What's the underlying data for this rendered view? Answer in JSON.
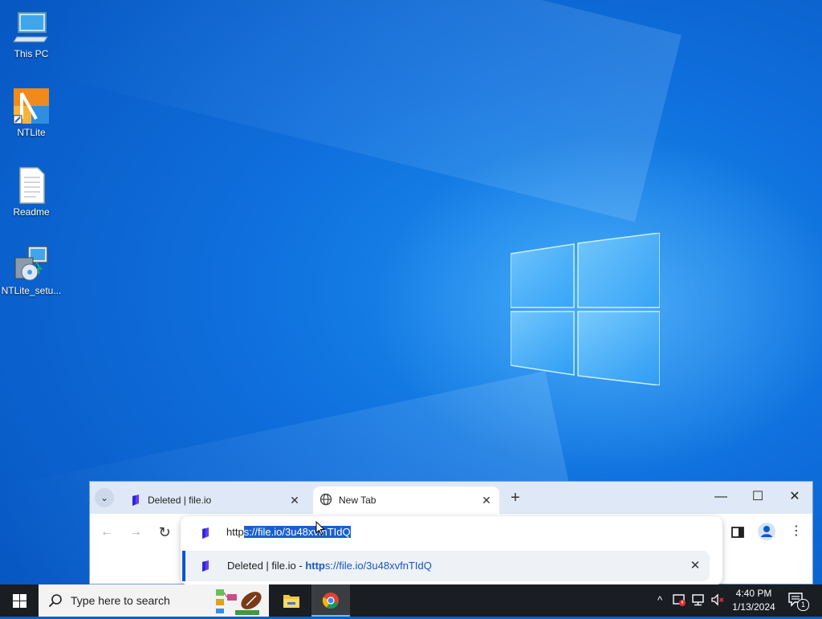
{
  "desktop": {
    "icons": [
      {
        "label": "This PC",
        "icon": "this-pc-icon"
      },
      {
        "label": "NTLite",
        "icon": "ntlite-icon"
      },
      {
        "label": "Readme",
        "icon": "text-document-icon"
      },
      {
        "label": "NTLite_setu...",
        "icon": "installer-icon"
      }
    ]
  },
  "browser": {
    "tabs": [
      {
        "title": "Deleted | file.io",
        "close": "✕"
      },
      {
        "title": "New Tab",
        "close": "✕"
      }
    ],
    "new_tab": "+",
    "window_controls": {
      "minimize": "—",
      "maximize": "☐",
      "close": "✕"
    },
    "nav": {
      "back": "←",
      "forward": "→",
      "reload": "↻"
    },
    "omnibox": {
      "value_prefix": "http",
      "value_selected": "s://file.io/3u48xvfnTIdQ"
    },
    "suggestion": {
      "title": "Deleted | file.io",
      "separator": " - ",
      "url_bold": "http",
      "url_rest": "s://file.io/3u48xvfnTIdQ",
      "remove": "✕"
    }
  },
  "taskbar": {
    "search_placeholder": "Type here to search",
    "clock_time": "4:40 PM",
    "clock_date": "1/13/2024",
    "notification_count": "1",
    "accent": "#0078d7"
  }
}
